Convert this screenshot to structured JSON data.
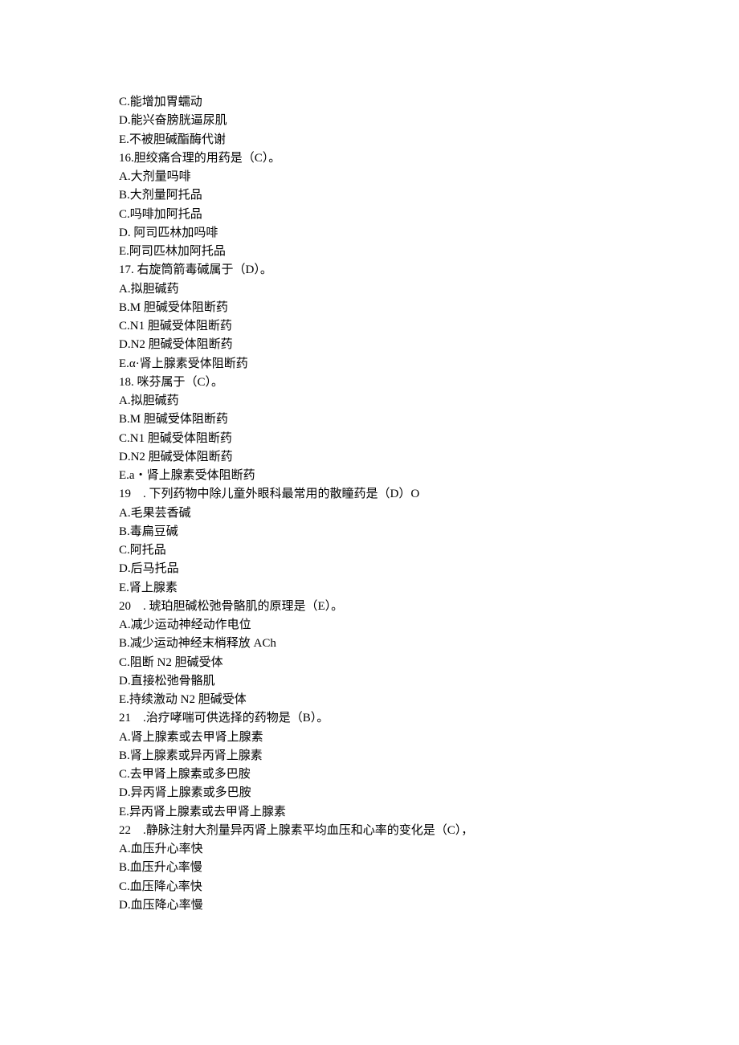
{
  "lines": [
    "C.能增加胃蠕动",
    "D.能兴奋膀胱逼尿肌",
    "E.不被胆碱酯酶代谢",
    "16.胆绞痛合理的用药是（C）。",
    "A.大剂量吗啡",
    "B.大剂量阿托品",
    "C.吗啡加阿托品",
    "D. 阿司匹林加吗啡",
    "E.阿司匹林加阿托品",
    "17. 右旋筒箭毒碱属于（D）。",
    "A.拟胆碱药",
    "B.M 胆碱受体阻断药",
    "C.N1 胆碱受体阻断药",
    "D.N2 胆碱受体阻断药",
    "E.α·肾上腺素受体阻断药",
    "18. 咪芬属于（C）。",
    "A.拟胆碱药",
    "B.M 胆碱受体阻断药",
    "C.N1 胆碱受体阻断药",
    "D.N2 胆碱受体阻断药",
    "E.a・肾上腺素受体阻断药",
    "19    . 下列药物中除儿童外眼科最常用的散瞳药是（D）O",
    "A.毛果芸香碱",
    "B.毒扁豆碱",
    "C.阿托品",
    "D.后马托品",
    "E.肾上腺素",
    "20    . 琥珀胆碱松弛骨骼肌的原理是（E）。",
    "A.减少运动神经动作电位",
    "B.减少运动神经末梢释放 ACh",
    "C.阻断 N2 胆碱受体",
    "D.直接松弛骨骼肌",
    "E.持续激动 N2 胆碱受体",
    "21    .治疗哮喘可供选择的药物是（B）。",
    "A.肾上腺素或去甲肾上腺素",
    "B.肾上腺素或异丙肾上腺素",
    "C.去甲肾上腺素或多巴胺",
    "D.异丙肾上腺素或多巴胺",
    "E.异丙肾上腺素或去甲肾上腺素",
    "22    .静脉注射大剂量异丙肾上腺素平均血压和心率的变化是（C），",
    "A.血压升心率快",
    "B.血压升心率慢",
    "C.血压降心率快",
    "D.血压降心率慢"
  ]
}
